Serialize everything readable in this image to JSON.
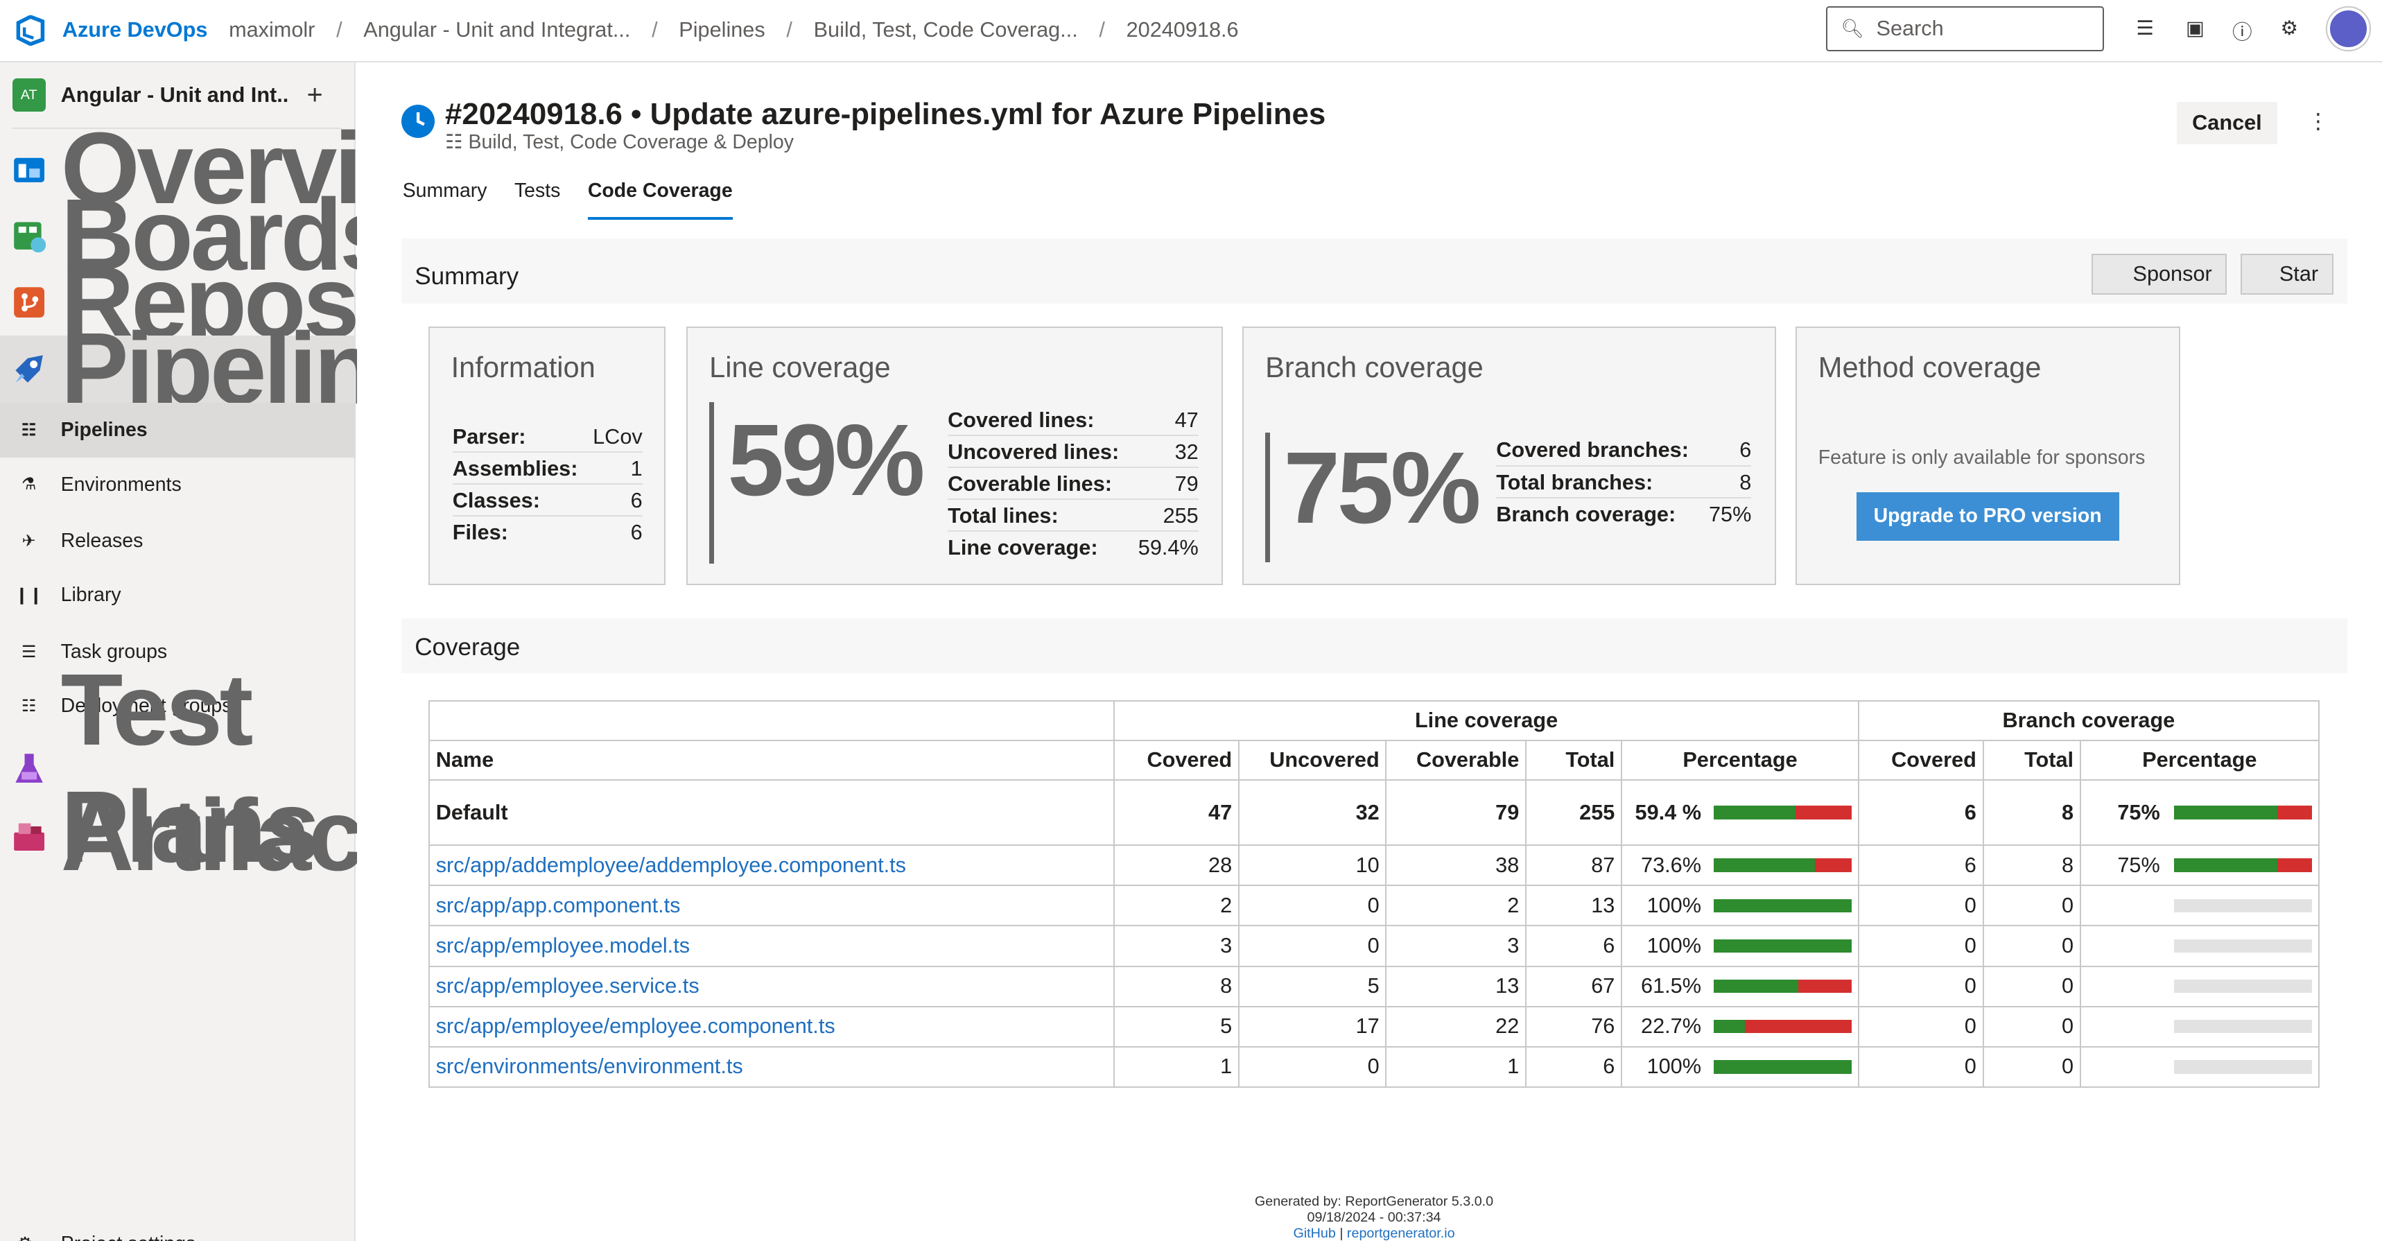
{
  "topbar": {
    "brand": "Azure DevOps",
    "crumbs": [
      "maximolr",
      "Angular - Unit and Integrat...",
      "Pipelines",
      "Build, Test, Code Coverag...",
      "20240918.6"
    ],
    "separator": "/",
    "search_placeholder": "Search"
  },
  "sidebar": {
    "project_initials": "AT",
    "project_name": "Angular - Unit and Int...",
    "items": [
      {
        "label": "Overview",
        "icon": "overview-icon"
      },
      {
        "label": "Boards",
        "icon": "boards-icon"
      },
      {
        "label": "Repos",
        "icon": "repos-icon"
      },
      {
        "label": "Pipelines",
        "icon": "pipelines-icon"
      },
      {
        "label": "Pipelines",
        "icon": "pipelines-sub-icon"
      },
      {
        "label": "Environments",
        "icon": "environments-icon"
      },
      {
        "label": "Releases",
        "icon": "releases-icon"
      },
      {
        "label": "Library",
        "icon": "library-icon"
      },
      {
        "label": "Task groups",
        "icon": "task-groups-icon"
      },
      {
        "label": "Deployment groups",
        "icon": "deployment-groups-icon"
      },
      {
        "label": "Test Plans",
        "icon": "test-plans-icon"
      },
      {
        "label": "Artifacts",
        "icon": "artifacts-icon"
      }
    ],
    "project_settings": "Project settings"
  },
  "header": {
    "title": "#20240918.6 • Update azure-pipelines.yml for Azure Pipelines",
    "subtitle": "Build, Test, Code Coverage & Deploy",
    "cancel": "Cancel",
    "tabs": [
      "Summary",
      "Tests",
      "Code Coverage"
    ]
  },
  "report": {
    "summary_title": "Summary",
    "sponsor": "Sponsor",
    "star": "Star",
    "information": {
      "title": "Information",
      "rows": [
        [
          "Parser:",
          "LCov"
        ],
        [
          "Assemblies:",
          "1"
        ],
        [
          "Classes:",
          "6"
        ],
        [
          "Files:",
          "6"
        ]
      ]
    },
    "line": {
      "title": "Line coverage",
      "big": "59%",
      "rows": [
        [
          "Covered lines:",
          "47"
        ],
        [
          "Uncovered lines:",
          "32"
        ],
        [
          "Coverable lines:",
          "79"
        ],
        [
          "Total lines:",
          "255"
        ],
        [
          "Line coverage:",
          "59.4%"
        ]
      ]
    },
    "branch": {
      "title": "Branch coverage",
      "big": "75%",
      "rows": [
        [
          "Covered branches:",
          "6"
        ],
        [
          "Total branches:",
          "8"
        ],
        [
          "Branch coverage:",
          "75%"
        ]
      ]
    },
    "method": {
      "title": "Method coverage",
      "note": "Feature is only available for sponsors",
      "button": "Upgrade to PRO version"
    },
    "coverage_title": "Coverage",
    "table": {
      "group_line": "Line coverage",
      "group_branch": "Branch coverage",
      "headers": [
        "Name",
        "Covered",
        "Uncovered",
        "Coverable",
        "Total",
        "Percentage",
        "Covered",
        "Total",
        "Percentage"
      ],
      "rows": [
        {
          "name": "Default",
          "covered": "47",
          "uncovered": "32",
          "coverable": "79",
          "total": "255",
          "pct": "59.4 %",
          "line_frac": 0.594,
          "bcovered": "6",
          "btotal": "8",
          "bpct": "75%",
          "branch_frac": 0.75
        },
        {
          "name": "src/app/addemployee/addemployee.component.ts",
          "covered": "28",
          "uncovered": "10",
          "coverable": "38",
          "total": "87",
          "pct": "73.6%",
          "line_frac": 0.736,
          "bcovered": "6",
          "btotal": "8",
          "bpct": "75%",
          "branch_frac": 0.75
        },
        {
          "name": "src/app/app.component.ts",
          "covered": "2",
          "uncovered": "0",
          "coverable": "2",
          "total": "13",
          "pct": "100%",
          "line_frac": 1.0,
          "bcovered": "0",
          "btotal": "0",
          "bpct": "",
          "branch_frac": null
        },
        {
          "name": "src/app/employee.model.ts",
          "covered": "3",
          "uncovered": "0",
          "coverable": "3",
          "total": "6",
          "pct": "100%",
          "line_frac": 1.0,
          "bcovered": "0",
          "btotal": "0",
          "bpct": "",
          "branch_frac": null
        },
        {
          "name": "src/app/employee.service.ts",
          "covered": "8",
          "uncovered": "5",
          "coverable": "13",
          "total": "67",
          "pct": "61.5%",
          "line_frac": 0.615,
          "bcovered": "0",
          "btotal": "0",
          "bpct": "",
          "branch_frac": null
        },
        {
          "name": "src/app/employee/employee.component.ts",
          "covered": "5",
          "uncovered": "17",
          "coverable": "22",
          "total": "76",
          "pct": "22.7%",
          "line_frac": 0.227,
          "bcovered": "0",
          "btotal": "0",
          "bpct": "",
          "branch_frac": null
        },
        {
          "name": "src/environments/environment.ts",
          "covered": "1",
          "uncovered": "0",
          "coverable": "1",
          "total": "6",
          "pct": "100%",
          "line_frac": 1.0,
          "bcovered": "0",
          "btotal": "0",
          "bpct": "",
          "branch_frac": null
        }
      ]
    },
    "footer": {
      "generated": "Generated by: ReportGenerator 5.3.0.0",
      "date": "09/18/2024 - 00:37:34",
      "github": "GitHub",
      "pipe": "|",
      "site": "reportgenerator.io"
    }
  },
  "colors": {
    "accent": "#0078d4",
    "covered": "#2e8b2e",
    "uncovered": "#d42f2f",
    "pro_button": "#3c8fd4"
  }
}
